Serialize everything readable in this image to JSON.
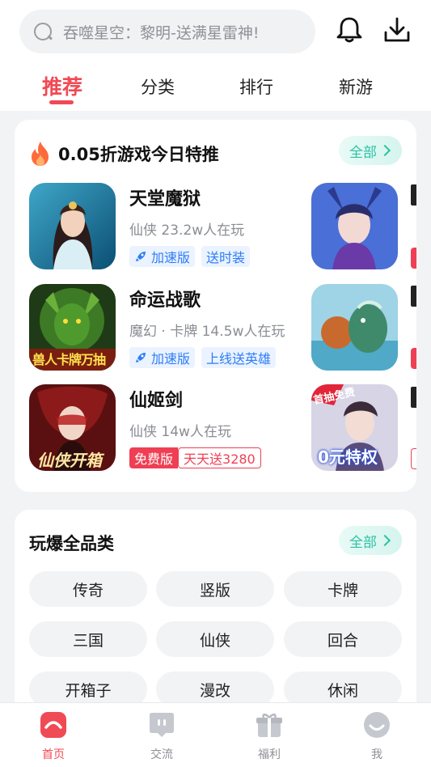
{
  "search": {
    "placeholder": "吞噬星空：黎明-送满星雷神!"
  },
  "tabs": [
    "推荐",
    "分类",
    "排行",
    "新游"
  ],
  "colors": {
    "accent": "#f04a55",
    "teal": "#2cc3a4",
    "blue_tag": "#2f7cf6"
  },
  "featured": {
    "title": "0.05折游戏今日特推",
    "all_label": "全部",
    "games": [
      {
        "name": "天堂魔狱",
        "meta": "仙侠  23.2w人在玩",
        "tags": [
          "加速版",
          "送时装"
        ]
      },
      {
        "name": "命运战歌",
        "meta": "魔幻 · 卡牌  14.5w人在玩",
        "tags": [
          "加速版",
          "上线送英雄"
        ],
        "icon_text": "兽人卡牌万抽"
      },
      {
        "name": "仙姬剑",
        "meta": "仙侠  14w人在玩",
        "tags": [
          "免费版",
          "天天送3280"
        ],
        "icon_text": "仙侠开箱"
      }
    ],
    "peek_texts": [
      "首抽免费",
      "0元特权"
    ]
  },
  "categories": {
    "title": "玩爆全品类",
    "all_label": "全部",
    "items": [
      "传奇",
      "竖版",
      "卡牌",
      "三国",
      "仙侠",
      "回合",
      "开箱子",
      "漫改",
      "休闲"
    ]
  },
  "bottom_nav": [
    {
      "label": "首页",
      "icon": "home-icon",
      "active": true
    },
    {
      "label": "交流",
      "icon": "chat-icon",
      "active": false
    },
    {
      "label": "福利",
      "icon": "gift-icon",
      "active": false
    },
    {
      "label": "我",
      "icon": "profile-icon",
      "active": false
    }
  ]
}
